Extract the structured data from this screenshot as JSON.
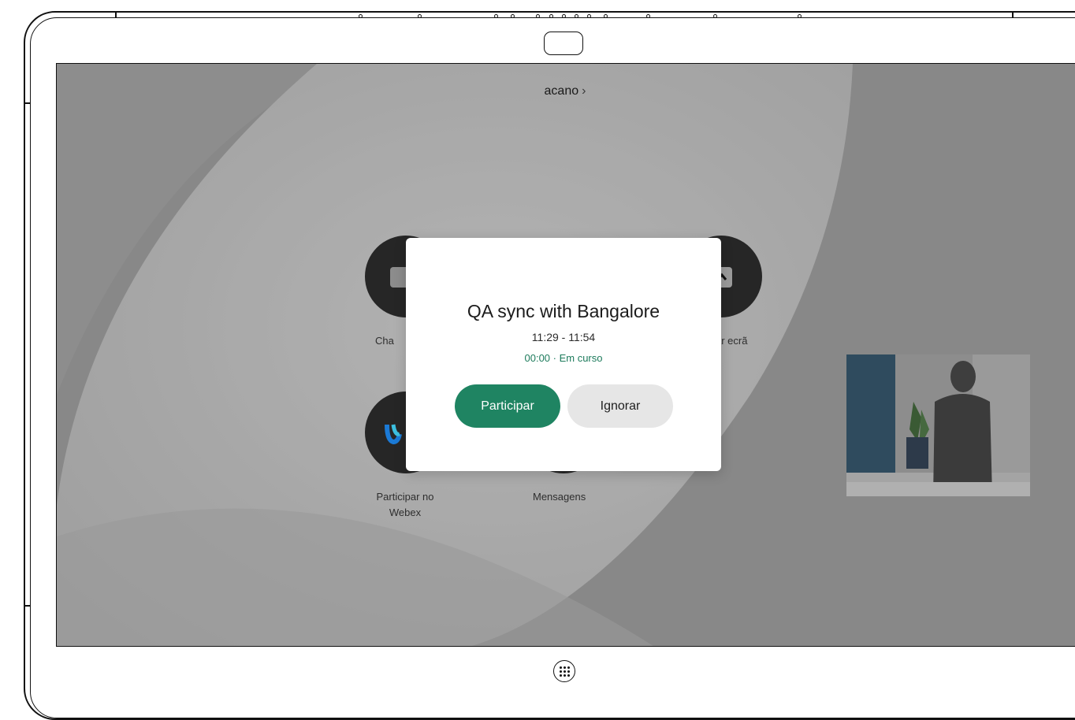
{
  "header": {
    "title": "acano",
    "chevron": "›"
  },
  "apps": [
    {
      "id": "call",
      "label": "Cha"
    },
    {
      "id": "share-screen",
      "label": "ar ecrã"
    },
    {
      "id": "webex",
      "label": "Participar no Webex",
      "line1": "Participar no",
      "line2": "Webex"
    },
    {
      "id": "messages",
      "label": "Mensagens"
    }
  ],
  "dialog": {
    "title": "QA sync with Bangalore",
    "time": "11:29 - 11:54",
    "status": "00:00 · Em curso",
    "join_label": "Participar",
    "ignore_label": "Ignorar"
  },
  "icons": {
    "home": "grid-dots-icon",
    "camera": "camera-icon",
    "webex": "webex-logo-icon",
    "share": "share-arrow-icon"
  },
  "colors": {
    "join_button": "#1f8462",
    "ignore_button": "#e6e6e6",
    "status_text": "#1d7b5c",
    "tile": "#262626"
  }
}
